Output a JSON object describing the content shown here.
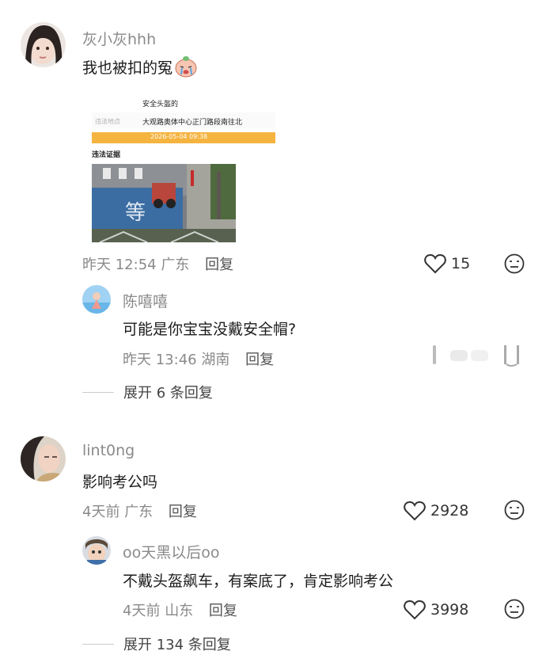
{
  "comments": [
    {
      "username": "灰小灰hhh",
      "text": "我也被扣的冤",
      "emoji_icon": "crying-baby-emoji",
      "image_card": {
        "title": "安全头盔的",
        "location_label": "违法地点",
        "location": "大观路奥体中心正门路段南往北",
        "datetime": "2026-05-04 09:38",
        "evidence_label": "违法证据"
      },
      "time": "昨天 12:54",
      "region": "广东",
      "reply_label": "回复",
      "likes": "15",
      "replies": [
        {
          "username": "陈嘻嘻",
          "text": "可能是你宝宝没戴安全帽?",
          "time": "昨天 13:46",
          "region": "湖南",
          "reply_label": "回复"
        }
      ],
      "expand_label": "展开 6 条回复"
    },
    {
      "username": "lint0ng",
      "text": "影响考公吗",
      "time": "4天前",
      "region": "广东",
      "reply_label": "回复",
      "likes": "2928",
      "replies": [
        {
          "username": "oo天黑以后oo",
          "text": "不戴头盔飙车，有案底了，肯定影响考公",
          "time": "4天前",
          "region": "山东",
          "reply_label": "回复",
          "likes": "3998"
        }
      ],
      "expand_label": "展开 134 条回复"
    }
  ],
  "colors": {
    "secondary_text": "#8a8a8a",
    "bar": "#f5b340"
  }
}
